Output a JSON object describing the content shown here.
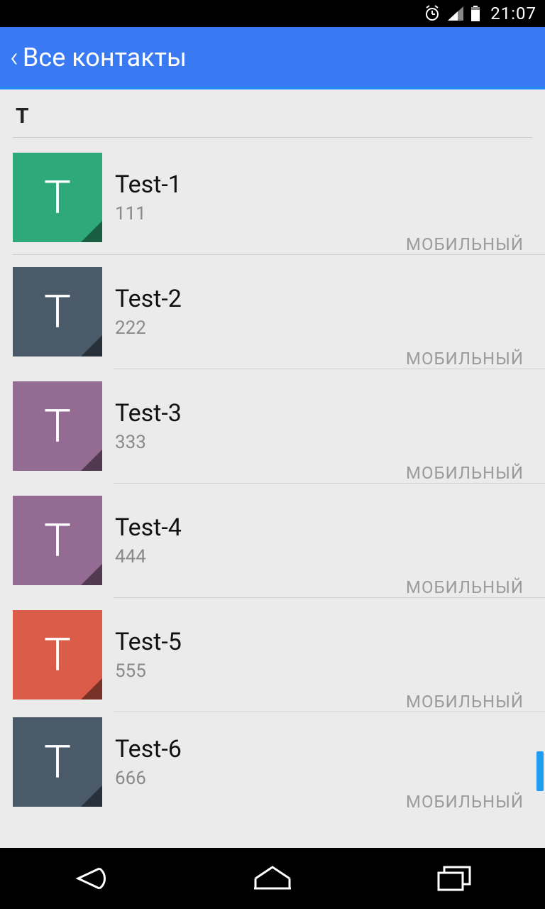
{
  "status": {
    "time": "21:07"
  },
  "header": {
    "title": "Все контакты"
  },
  "section_letter": "Т",
  "contacts": [
    {
      "letter": "T",
      "name": "Test-1",
      "number": "111",
      "type": "МОБИЛЬНЫЙ",
      "color": "#2fa97a"
    },
    {
      "letter": "T",
      "name": "Test-2",
      "number": "222",
      "type": "МОБИЛЬНЫЙ",
      "color": "#4a5a68"
    },
    {
      "letter": "T",
      "name": "Test-3",
      "number": "333",
      "type": "МОБИЛЬНЫЙ",
      "color": "#946b92"
    },
    {
      "letter": "T",
      "name": "Test-4",
      "number": "444",
      "type": "МОБИЛЬНЫЙ",
      "color": "#946b92"
    },
    {
      "letter": "T",
      "name": "Test-5",
      "number": "555",
      "type": "МОБИЛЬНЫЙ",
      "color": "#db5c49"
    },
    {
      "letter": "T",
      "name": "Test-6",
      "number": "666",
      "type": "МОБИЛЬНЫЙ",
      "color": "#4a5a68"
    }
  ]
}
